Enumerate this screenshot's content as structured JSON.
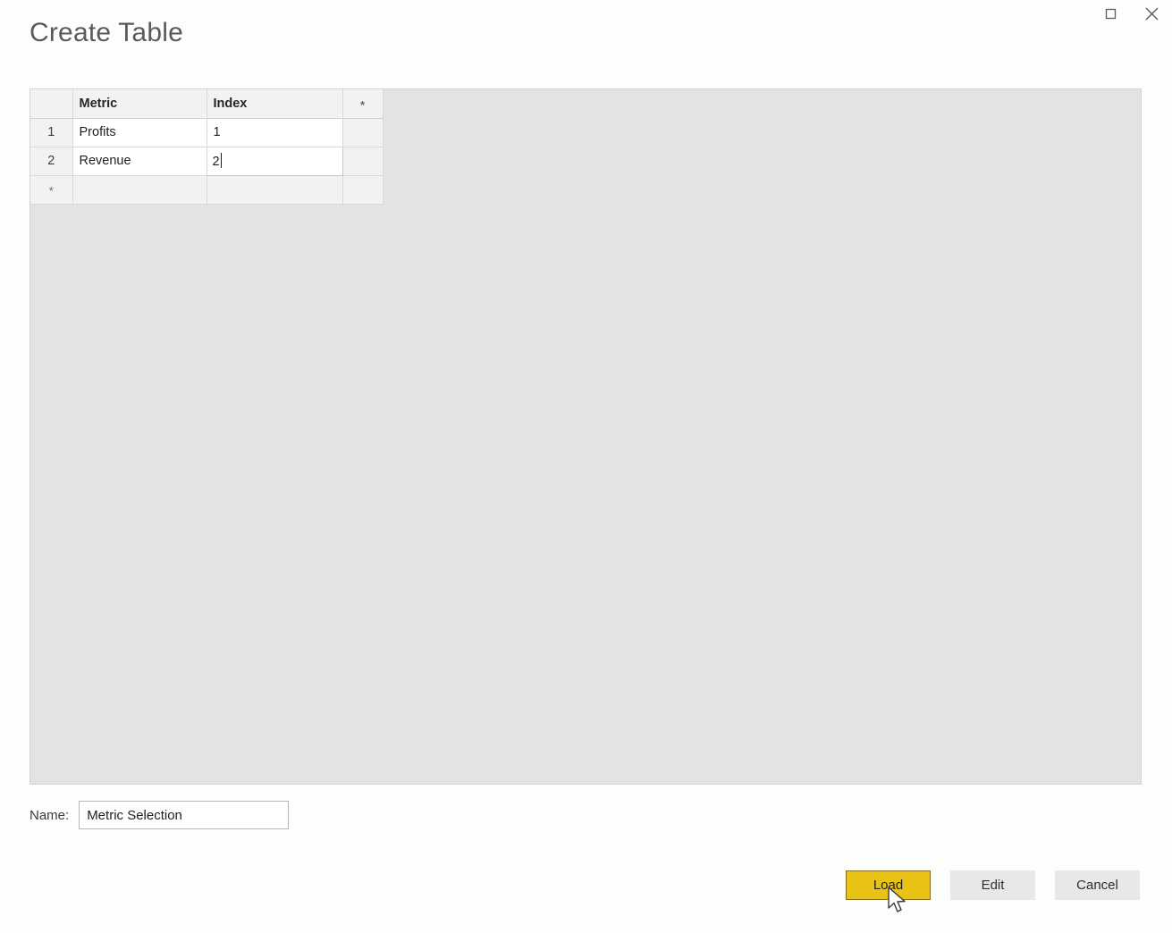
{
  "window": {
    "title": "Create Table",
    "controls": [
      {
        "name": "maximize-button",
        "icon": "maximize-icon",
        "label": ""
      },
      {
        "name": "close-button",
        "icon": "close-icon",
        "label": ""
      }
    ]
  },
  "grid": {
    "columns": [
      "",
      "Metric",
      "Index",
      "*"
    ],
    "rows": [
      {
        "header": "1",
        "metric": "Profits",
        "index": "1"
      },
      {
        "header": "2",
        "metric": "Revenue",
        "index": "2"
      }
    ],
    "new_row": {
      "header": "*",
      "metric": "",
      "index": ""
    },
    "editing_cell": {
      "row": 2,
      "column": "Index",
      "value": "2"
    }
  },
  "name_field": {
    "label": "Name:",
    "value": "Metric Selection",
    "placeholder": ""
  },
  "footer": {
    "load_label": "Load",
    "edit_label": "Edit",
    "cancel_label": "Cancel"
  },
  "colors": {
    "accent": "#e8c313",
    "accent_border": "#8a6d1a",
    "button_bg": "#e8e8e8",
    "panel_bg": "#e3e3e3",
    "grid_header_bg": "#f2f2f2",
    "active_cell_bg": "#e4e4e4",
    "page_bg": "#fdfdfc"
  }
}
